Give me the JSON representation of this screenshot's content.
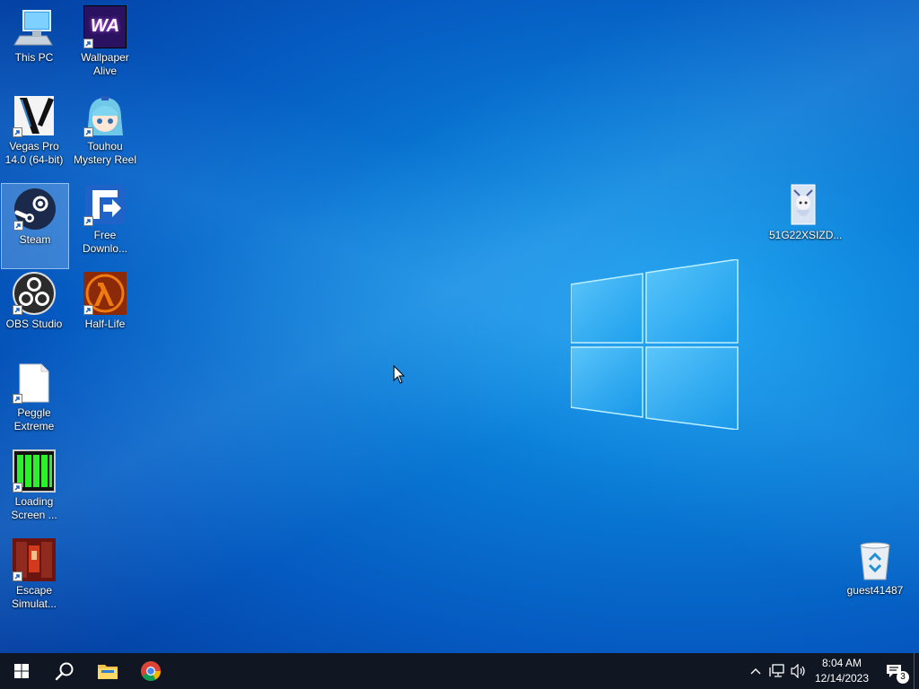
{
  "desktop_icons": {
    "this_pc": "This PC",
    "wallpaper_alive": "Wallpaper Alive",
    "vegas_pro": "Vegas Pro 14.0 (64-bit)",
    "touhou": "Touhou Mystery Reel",
    "steam": "Steam",
    "free_download": "Free Downlo...",
    "obs": "OBS Studio",
    "half_life": "Half-Life",
    "peggle": "Peggle Extreme",
    "loading_screen": "Loading Screen ...",
    "escape_sim": "Escape Simulat...",
    "image_file": "51G22XSIZD...",
    "recycle_bin": "guest41487"
  },
  "wallpaper_alive_logo": "WA",
  "taskbar": {
    "clock_time": "8:04 AM",
    "clock_date": "12/14/2023",
    "notification_count": "3"
  },
  "colors": {
    "taskbar": "#101722",
    "desktop_accent": "#0a7fd8"
  }
}
